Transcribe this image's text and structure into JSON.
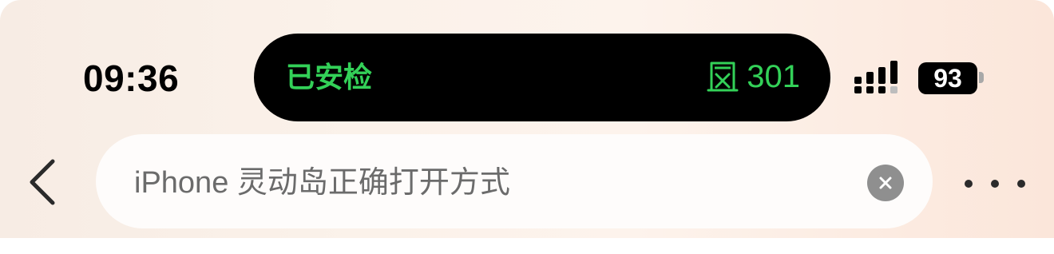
{
  "status_bar": {
    "time": "09:36",
    "battery_level": "93",
    "signal_icon": "cellular-signal-icon"
  },
  "dynamic_island": {
    "left_text": "已安检",
    "right_icon": "boarding-gate-icon",
    "right_text": "301",
    "text_color": "#33d158"
  },
  "nav": {
    "back_icon": "chevron-left-icon",
    "search": {
      "value": "iPhone 灵动岛正确打开方式",
      "clear_icon": "clear-x-icon"
    },
    "more_icon": "more-dots-icon"
  }
}
